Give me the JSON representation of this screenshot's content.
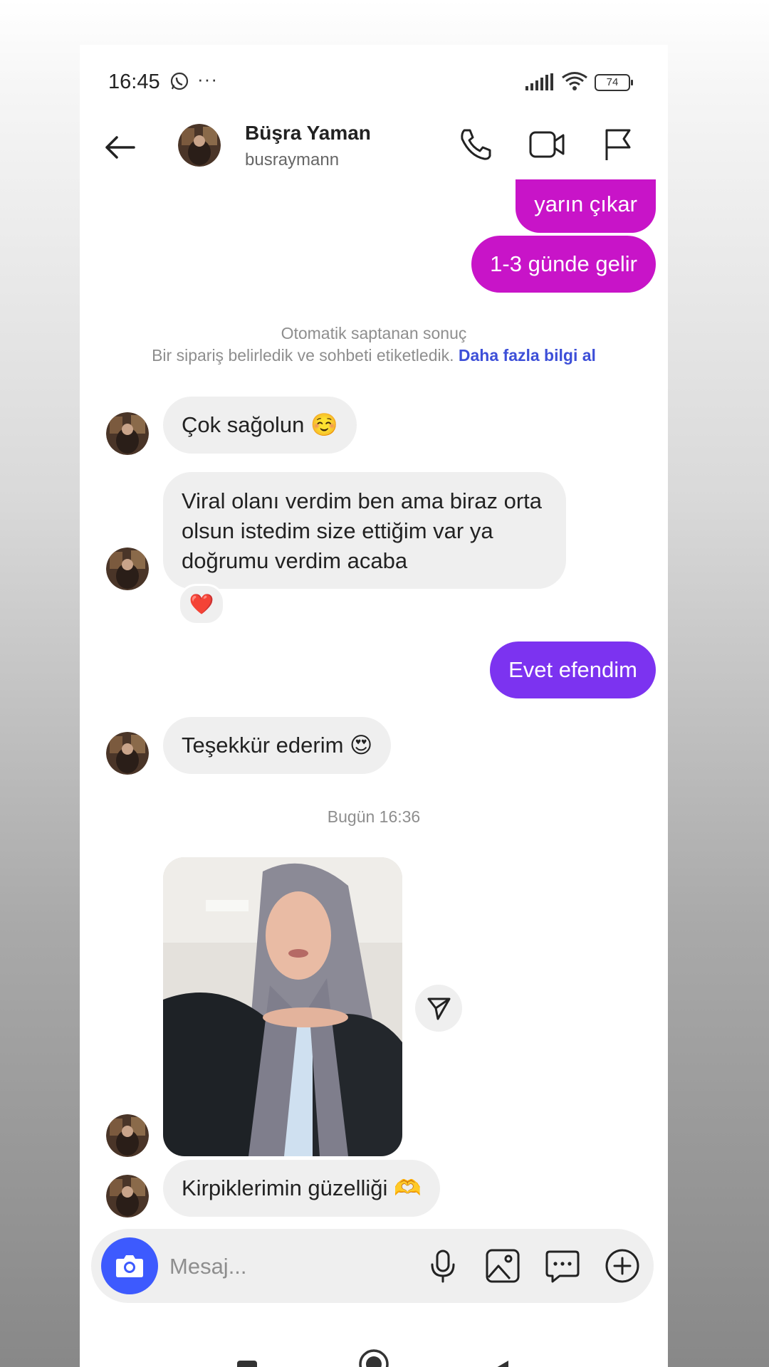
{
  "status_bar": {
    "time": "16:45",
    "dots": "···",
    "battery": "74"
  },
  "header": {
    "name": "Büşra Yaman",
    "username": "busraymann"
  },
  "messages": {
    "out1": "yarın çıkar",
    "out2": "1-3 günde gelir",
    "system_title": "Otomatik saptanan sonuç",
    "system_text": "Bir sipariş belirledik ve sohbeti etiketledik.",
    "system_link": "Daha fazla bilgi al",
    "in1": "Çok sağolun ☺️",
    "in2": "Viral olanı verdim ben ama biraz orta olsun istedim size ettiğim var ya doğrumu verdim acaba",
    "reaction": "❤️",
    "out3": "Evet efendim",
    "in3": "Teşekkür ederim 😍",
    "timestamp": "Bugün 16:36",
    "in4": "Kirpiklerimin güzelliği 🫶"
  },
  "composer": {
    "placeholder": "Mesaj..."
  },
  "colors": {
    "outgoing_magenta": "#c814c8",
    "outgoing_purple": "#7c33f0",
    "incoming_bg": "#efefef",
    "link": "#3d4fd8",
    "camera_button": "#3d5afe"
  },
  "icons": [
    "whatsapp-icon",
    "signal-icon",
    "wifi-icon",
    "back-arrow-icon",
    "phone-icon",
    "video-icon",
    "flag-icon",
    "share-icon",
    "camera-icon",
    "mic-icon",
    "gallery-icon",
    "sticker-icon",
    "plus-icon",
    "nav-square-icon",
    "nav-home-icon",
    "nav-back-icon"
  ]
}
